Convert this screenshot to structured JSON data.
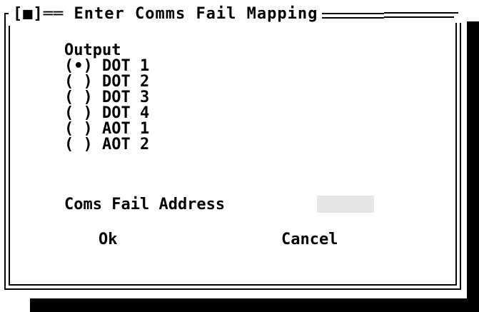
{
  "dialog": {
    "close_box": "[■]",
    "title": "Enter Comms Fail Mapping"
  },
  "output": {
    "heading": "Output",
    "options": [
      {
        "mark": "(•)",
        "label": "DOT 1",
        "selected": true
      },
      {
        "mark": "( )",
        "label": "DOT 2",
        "selected": false
      },
      {
        "mark": "( )",
        "label": "DOT 3",
        "selected": false
      },
      {
        "mark": "( )",
        "label": "DOT 4",
        "selected": false
      },
      {
        "mark": "( )",
        "label": "AOT 1",
        "selected": false
      },
      {
        "mark": "( )",
        "label": "AOT 2",
        "selected": false
      }
    ]
  },
  "address": {
    "label": "Coms Fail Address",
    "value": ""
  },
  "buttons": {
    "ok": "Ok",
    "cancel": "Cancel"
  }
}
